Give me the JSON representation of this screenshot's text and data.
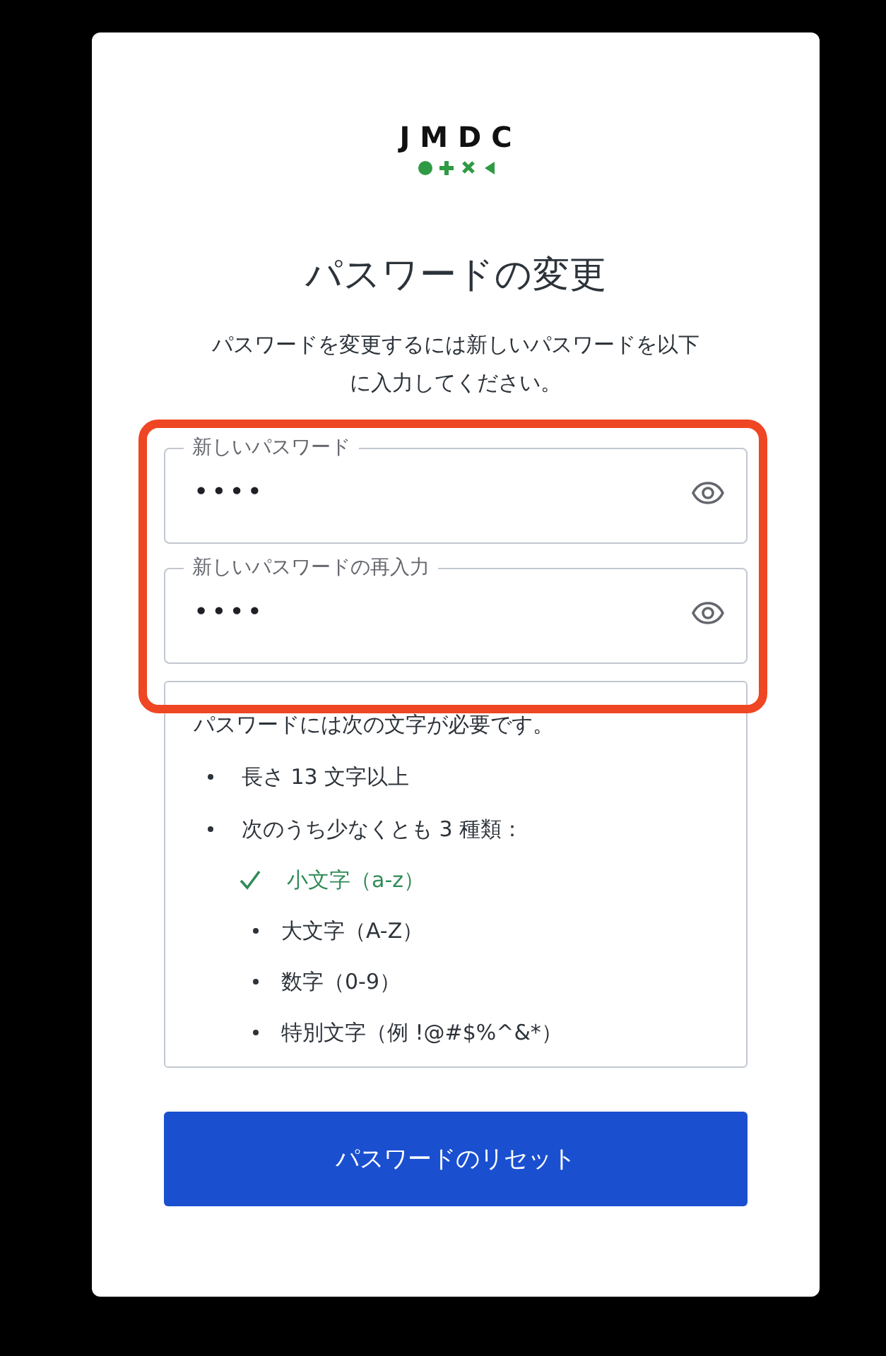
{
  "logo": {
    "text": "JMDC"
  },
  "title": "パスワードの変更",
  "description": "パスワードを変更するには新しいパスワードを以下に入力してください。",
  "fields": [
    {
      "label": "新しいパスワード",
      "value": "••••"
    },
    {
      "label": "新しいパスワードの再入力",
      "value": "••••"
    }
  ],
  "requirements": {
    "intro": "パスワードには次の文字が必要です。",
    "items": [
      {
        "text": "長さ 13 文字以上"
      },
      {
        "text": "次のうち少なくとも 3 種類：",
        "children": [
          {
            "text": "小文字（a-z）",
            "met": true
          },
          {
            "text": "大文字（A-Z）",
            "met": false
          },
          {
            "text": "数字（0-9）",
            "met": false
          },
          {
            "text": "特別文字（例 !@#$%^&*）",
            "met": false
          }
        ]
      }
    ]
  },
  "submit": {
    "label": "パスワードのリセット"
  }
}
